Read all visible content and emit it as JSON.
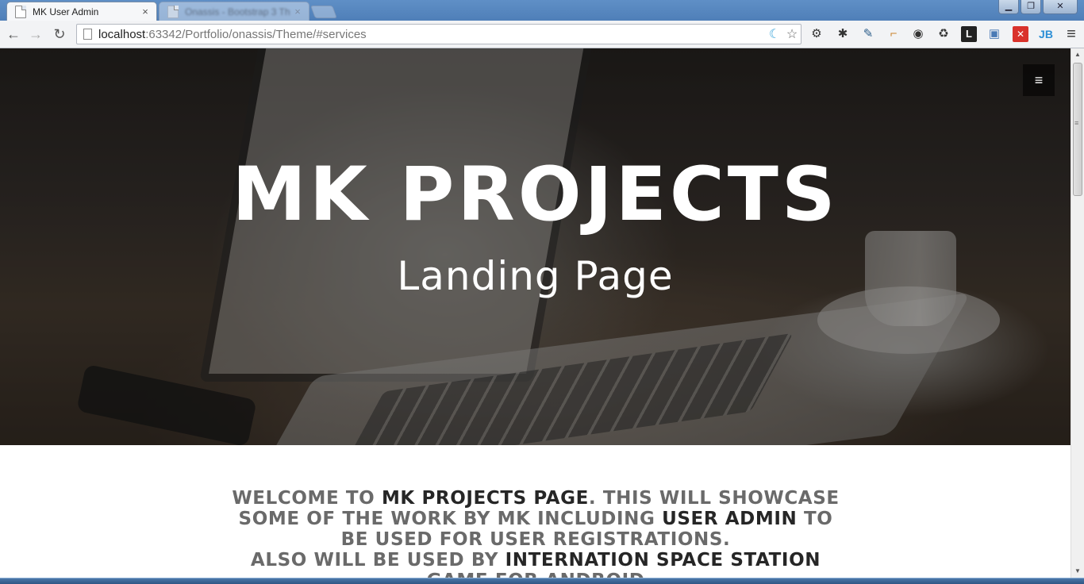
{
  "browser": {
    "tabs": [
      {
        "title": "MK User Admin",
        "active": true
      },
      {
        "title": "Onassis - Bootstrap 3 Th",
        "active": false
      }
    ],
    "tab_close_glyph": "×",
    "window_buttons": {
      "minimize": "▁",
      "maximize": "❐",
      "close": "✕"
    },
    "nav": {
      "back": "←",
      "forward": "→",
      "reload": "↻"
    },
    "address": {
      "host": "localhost",
      "path": ":63342/Portfolio/onassis/Theme/#services"
    },
    "omnibox_icons": {
      "moon": "☾",
      "star": "☆"
    },
    "extensions": [
      {
        "name": "gear-icon",
        "glyph": "⚙",
        "color": "#333333"
      },
      {
        "name": "bug-icon",
        "glyph": "✱",
        "color": "#444444"
      },
      {
        "name": "eyedropper-icon",
        "glyph": "✎",
        "color": "#2b5d8a"
      },
      {
        "name": "ruler-icon",
        "glyph": "⌐",
        "color": "#c9822a"
      },
      {
        "name": "settings-circle-icon",
        "glyph": "◉",
        "color": "#222222"
      },
      {
        "name": "recycle-icon",
        "glyph": "♻",
        "color": "#444444"
      },
      {
        "name": "l-extension-icon",
        "glyph": "L",
        "color": "#ffffff"
      },
      {
        "name": "window-extension-icon",
        "glyph": "▣",
        "color": "#4a7ab5"
      },
      {
        "name": "x-extension-icon",
        "glyph": "✕",
        "color": "#ffffff"
      },
      {
        "name": "jb-extension-icon",
        "glyph": "JB",
        "color": "#2c8fd6"
      },
      {
        "name": "chrome-menu-icon",
        "glyph": "≡",
        "color": "#333333"
      }
    ]
  },
  "page": {
    "menu_glyph": "≡",
    "hero": {
      "title": "MK PROJECTS",
      "subtitle": "Landing Page"
    },
    "intro": {
      "p1": "Welcome to ",
      "h1": "MK Projects Page",
      "p2": ". This will showcase some of the work by MK including ",
      "h2": "User Admin",
      "p3": " to be used for user registrations.",
      "p4": "Also will be used by ",
      "h3": "Internation Space Station",
      "p5": " game for android"
    }
  },
  "scrollbar": {
    "up": "▲",
    "down": "▼",
    "grip": "≡"
  }
}
